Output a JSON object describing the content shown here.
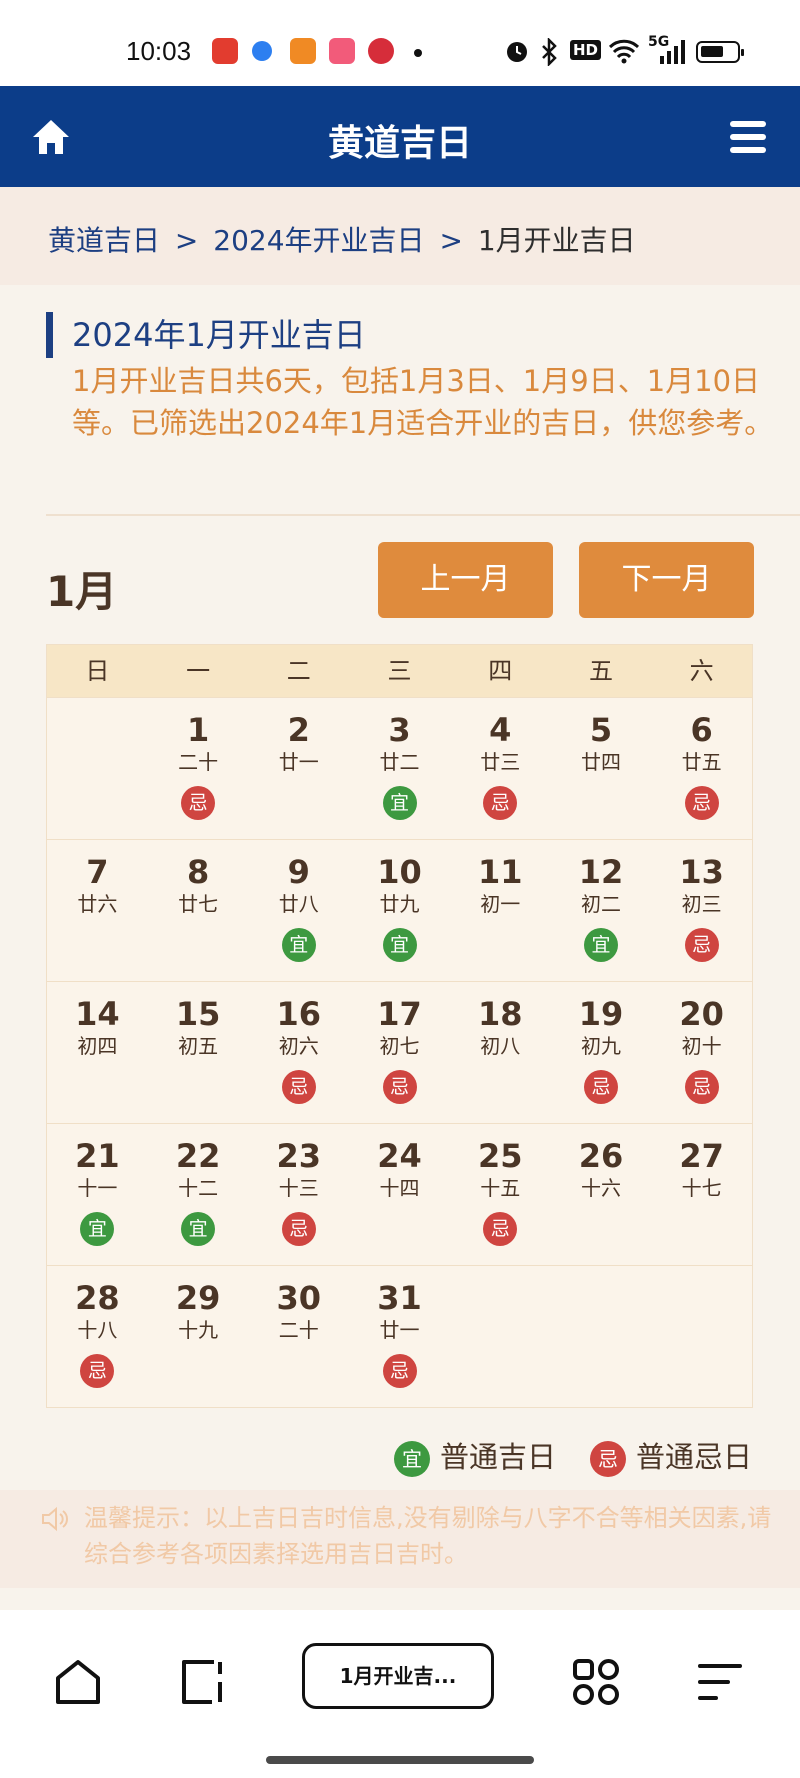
{
  "status_bar": {
    "time": "10:03",
    "network": "5G",
    "hd_label": "HD"
  },
  "header": {
    "title": "黄道吉日"
  },
  "breadcrumb": {
    "items": [
      "黄道吉日",
      "2024年开业吉日",
      "1月开业吉日"
    ],
    "separator": ">"
  },
  "intro": {
    "title": "2024年1月开业吉日",
    "description": "1月开业吉日共6天，包括1月3日、1月9日、1月10日等。已筛选出2024年1月适合开业的吉日，供您参考。"
  },
  "calendar": {
    "month_label": "1月",
    "prev_label": "上一月",
    "next_label": "下一月",
    "weekdays": [
      "日",
      "一",
      "二",
      "三",
      "四",
      "五",
      "六"
    ],
    "weeks": [
      [
        null,
        {
          "day": "1",
          "lunar": "二十",
          "mark": "忌",
          "type": "ji"
        },
        {
          "day": "2",
          "lunar": "廿一",
          "mark": "",
          "type": ""
        },
        {
          "day": "3",
          "lunar": "廿二",
          "mark": "宜",
          "type": "yi"
        },
        {
          "day": "4",
          "lunar": "廿三",
          "mark": "忌",
          "type": "ji"
        },
        {
          "day": "5",
          "lunar": "廿四",
          "mark": "",
          "type": ""
        },
        {
          "day": "6",
          "lunar": "廿五",
          "mark": "忌",
          "type": "ji"
        }
      ],
      [
        {
          "day": "7",
          "lunar": "廿六",
          "mark": "",
          "type": ""
        },
        {
          "day": "8",
          "lunar": "廿七",
          "mark": "",
          "type": ""
        },
        {
          "day": "9",
          "lunar": "廿八",
          "mark": "宜",
          "type": "yi"
        },
        {
          "day": "10",
          "lunar": "廿九",
          "mark": "宜",
          "type": "yi"
        },
        {
          "day": "11",
          "lunar": "初一",
          "mark": "",
          "type": ""
        },
        {
          "day": "12",
          "lunar": "初二",
          "mark": "宜",
          "type": "yi"
        },
        {
          "day": "13",
          "lunar": "初三",
          "mark": "忌",
          "type": "ji"
        }
      ],
      [
        {
          "day": "14",
          "lunar": "初四",
          "mark": "",
          "type": ""
        },
        {
          "day": "15",
          "lunar": "初五",
          "mark": "",
          "type": ""
        },
        {
          "day": "16",
          "lunar": "初六",
          "mark": "忌",
          "type": "ji"
        },
        {
          "day": "17",
          "lunar": "初七",
          "mark": "忌",
          "type": "ji"
        },
        {
          "day": "18",
          "lunar": "初八",
          "mark": "",
          "type": ""
        },
        {
          "day": "19",
          "lunar": "初九",
          "mark": "忌",
          "type": "ji"
        },
        {
          "day": "20",
          "lunar": "初十",
          "mark": "忌",
          "type": "ji"
        }
      ],
      [
        {
          "day": "21",
          "lunar": "十一",
          "mark": "宜",
          "type": "yi"
        },
        {
          "day": "22",
          "lunar": "十二",
          "mark": "宜",
          "type": "yi"
        },
        {
          "day": "23",
          "lunar": "十三",
          "mark": "忌",
          "type": "ji"
        },
        {
          "day": "24",
          "lunar": "十四",
          "mark": "",
          "type": ""
        },
        {
          "day": "25",
          "lunar": "十五",
          "mark": "忌",
          "type": "ji"
        },
        {
          "day": "26",
          "lunar": "十六",
          "mark": "",
          "type": ""
        },
        {
          "day": "27",
          "lunar": "十七",
          "mark": "",
          "type": ""
        }
      ],
      [
        {
          "day": "28",
          "lunar": "十八",
          "mark": "忌",
          "type": "ji"
        },
        {
          "day": "29",
          "lunar": "十九",
          "mark": "",
          "type": ""
        },
        {
          "day": "30",
          "lunar": "二十",
          "mark": "",
          "type": ""
        },
        {
          "day": "31",
          "lunar": "廿一",
          "mark": "忌",
          "type": "ji"
        },
        null,
        null,
        null
      ]
    ]
  },
  "legend": {
    "yi_badge": "宜",
    "yi_label": "普通吉日",
    "ji_badge": "忌",
    "ji_label": "普通忌日"
  },
  "tip": {
    "text": "温馨提示：以上吉日吉时信息,没有剔除与八字不合等相关因素,请综合参考各项因素择选用吉日吉时。"
  },
  "browser_bar": {
    "url_label": "1月开业吉..."
  },
  "colors": {
    "header_bg": "#0c3d89",
    "accent_orange": "#df8b3d",
    "yi_green": "#3d9940",
    "ji_red": "#cf4540"
  }
}
